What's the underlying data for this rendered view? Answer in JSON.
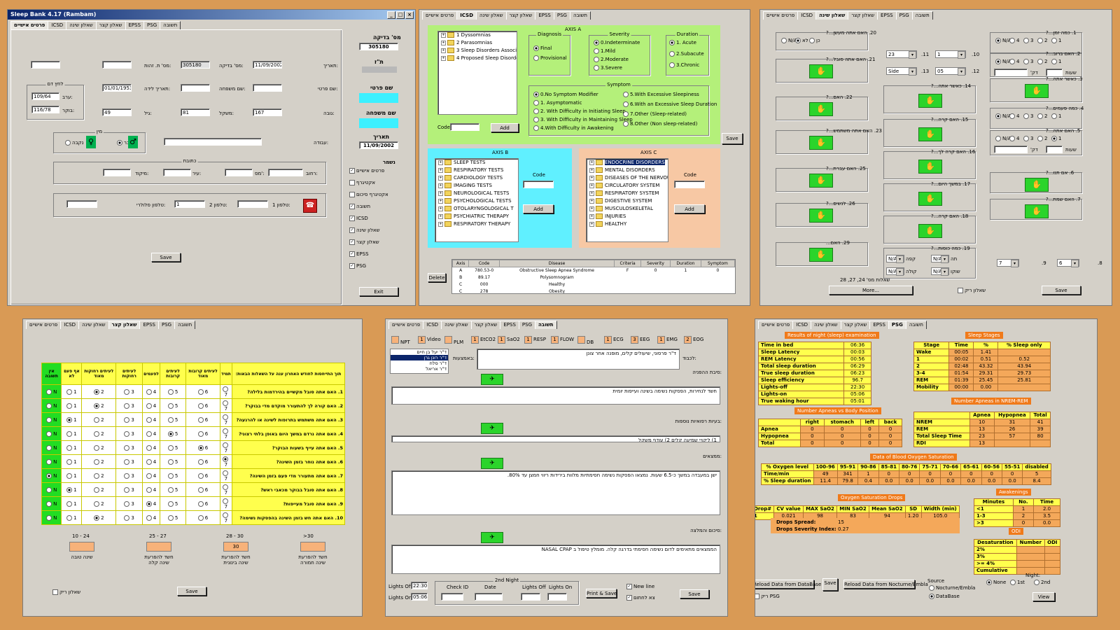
{
  "tabs_main": [
    "פרטים אישיים",
    "ICSD",
    "שאלון שינה",
    "שאלון קצר",
    "EPSS",
    "PSG",
    "תשובה"
  ],
  "p1": {
    "title": "Sleep Bank 4.17 (Rambam)",
    "test_no_label": "מס' בדיקה:",
    "test_no": "305180",
    "date_label": "תאריך:",
    "date": "11/09/2002",
    "id_label": "מס' ת. זהות:",
    "dob_label": "תאריך לידה:",
    "dob": "01/01/1953",
    "family_label": "שם משפחה:",
    "first_label": "שם פרטי:",
    "age_label": "גיל:",
    "age": "49",
    "weight_label": "משקל:",
    "weight": "81",
    "height_label": "גובה:",
    "height": "167",
    "bp_group": "לחץ דם",
    "bp_evening_label": "ערב:",
    "bp_evening": "109/64",
    "bp_morning_label": "בוקר:",
    "bp_morning": "116/78",
    "gender_group": "מין",
    "female": "נקבה",
    "male": "זכר",
    "work_label": "עבודה:",
    "address_group": "כתובת",
    "street_label": "רחוב:",
    "house_label": "מס':",
    "city_label": "עיר:",
    "zip_label": "מיקוד:",
    "phone1_label": "טלפון 1:",
    "phone2_label": "טלפון 2:",
    "phone2": "1",
    "cell_label": "טלפון סלולרי:",
    "save": "Save",
    "side_test_no_label": "מס' בדיקה",
    "side_test_no": "305180",
    "side_id_label": "ת\"ז",
    "side_first_label": "שם פרטי",
    "side_family_label": "שם משפחה",
    "side_date_label": "תאריך",
    "side_date": "11/09/2002",
    "exists_label": "נשמר",
    "checks": [
      {
        "label": "פרטים אישיים",
        "on": true
      },
      {
        "label": "אקטיגרף",
        "on": false
      },
      {
        "label": "אקטיגרף סיכום",
        "on": false
      },
      {
        "label": "תשובה",
        "on": true
      },
      {
        "label": "ICSD",
        "on": true
      },
      {
        "label": "שאלון שינה",
        "on": true
      },
      {
        "label": "שאלון קצר",
        "on": true
      },
      {
        "label": "EPSS",
        "on": true
      },
      {
        "label": "PSG",
        "on": true
      }
    ],
    "exit": "Exit"
  },
  "p2": {
    "axis_a": "AXIS A",
    "tree_a": [
      "1 Dyssomnias",
      "2 Parasomnias",
      "3 Sleep Disorders Associated w",
      "4 Proposed Sleep Disorders"
    ],
    "code_label": "Code",
    "add": "Add",
    "diagnosis": "Diagnosis",
    "diag_opts": [
      {
        "t": "Final",
        "on": true
      },
      {
        "t": "Provisional",
        "on": false
      }
    ],
    "severity": "Severity",
    "sev_opts": [
      {
        "t": "0.Indeterminate",
        "on": true
      },
      {
        "t": "1.Mild",
        "on": false
      },
      {
        "t": "2.Moderate",
        "on": false
      },
      {
        "t": "3.Severe",
        "on": false
      }
    ],
    "duration": "Duration",
    "dur_opts": [
      {
        "t": "1. Acute",
        "on": true
      },
      {
        "t": "2.Subacute",
        "on": false
      },
      {
        "t": "3.Chronic",
        "on": false
      }
    ],
    "symptom": "Symptom",
    "sym_left": [
      {
        "t": "0.No Symptom Modifier",
        "on": true
      },
      {
        "t": "1. Asymptomatic",
        "on": false
      },
      {
        "t": "2. With Difficulty in Initiating Sleep",
        "on": false
      },
      {
        "t": "3. With Difficulty in Maintaining Sleep",
        "on": false
      },
      {
        "t": "4.With Difficulty in Awakening",
        "on": false
      }
    ],
    "sym_right": [
      {
        "t": "5.With Excessive Sleepiness",
        "on": false
      },
      {
        "t": "6.With an Excessive Sleep Duration",
        "on": false
      },
      {
        "t": "7.Other (Sleep-related)",
        "on": false
      },
      {
        "t": "8.Other (Non sleep-related)",
        "on": false
      }
    ],
    "save": "Save",
    "axis_b": "AXIS B",
    "tree_b": [
      "SLEEP TESTS",
      "RESPIRATORY TESTS",
      "CARDIOLOGY TESTS",
      "IMAGING TESTS",
      "NEUROLOGICAL TESTS",
      "PSYCHOLOGICAL TESTS",
      "OTOLARYNGOLOGICAL T",
      "PSYCHIATRIC THERAPY",
      "RESPIRATORY THERAPY"
    ],
    "axis_c": "AXIS C",
    "tree_c": [
      "ENDOCRINE DISORDERS",
      "MENTAL DISORDERS",
      "DISEASES OF THE NERVOU",
      "CIRCULATORY SYSTEM",
      "RESPIRATORY SYSTEM",
      "DIGESTIVE SYSTEM",
      "MUSCULOSKELETAL",
      "INJURIES",
      "HEALTHY"
    ],
    "delete": "Delete",
    "grid_cols": [
      "Axis",
      "Code",
      "Disease",
      "Criteria",
      "Severity",
      "Duration",
      "Symptom"
    ],
    "grid_rows": [
      [
        "A",
        "780.53-0",
        "Obstructive Sleep Apnea Syndrome",
        "F",
        "0",
        "1",
        "0"
      ],
      [
        "B",
        "89.17",
        "Polysomnogram",
        "",
        "",
        "",
        ""
      ],
      [
        "C",
        "000",
        "Healthy",
        "",
        "",
        "",
        ""
      ],
      [
        "C",
        "278",
        "Obesity",
        "",
        "",
        "",
        ""
      ]
    ]
  },
  "p3": {
    "q_right": [
      "1. כמה זמן...?",
      "2. האם ברוב...?",
      "3. כאשר אתה...?",
      "4. כמה פעמים...?",
      "5. האם אתה...?",
      "6. אם תנו...?",
      "7. האם שמת...?"
    ],
    "q_mid": [
      "10.",
      "11.",
      "12.",
      "13.",
      "14. כאשר אתה...?",
      "15. האם קרה...?",
      "16. האם קרה לך...?",
      "17. במשך היום...?",
      "18. האם קרה...?",
      "19. כמה כוסות...?"
    ],
    "q_left": [
      "20. האם אתה מעשן...?",
      "21. האם אתה סובל...?",
      "22. האם...?",
      "23. האם אתה משתמש...?",
      "25. האם עברת...?",
      "26. לנשים...?",
      "29. האם..."
    ],
    "radio_opts": [
      "N/A",
      "4",
      "3",
      "2",
      "1"
    ],
    "yes_no": [
      "N/A",
      "לא",
      "כן"
    ],
    "dd1": "23",
    "dd2": "1",
    "dd3": "Side",
    "dd4": "05",
    "dd_na": "N/A",
    "minutes_label": "דק'",
    "hours_label": "שעות",
    "q9": "9.",
    "q8": "8.",
    "dd7": "7",
    "dd6": "6",
    "coffee": "קפה",
    "tea": "תה",
    "cola": "קולה",
    "choc": "שוקו",
    "more_caption": "שאלות מס' 24, 27, 28",
    "more": "More...",
    "empty_q": "שאלון ריק",
    "save": "Save"
  },
  "p4": {
    "headers": [
      "אין תשובה",
      "אף פעם לא",
      "לעיתים רחוקות מאוד",
      "לעיתים רחוקות",
      "לפעמים",
      "לעיתים קרובות",
      "לעיתים קרובות מאוד",
      "תמיד",
      "תוך התייחסות לחודש האחרון ענה על השאלות הבאות:"
    ],
    "rows": [
      {
        "q": "1. האם אתה סובל מקשיים בהירדמות בלילה?",
        "sel": 2
      },
      {
        "q": "2. האם קורה לך להתעורר מוקדם מדי בבוקר?",
        "sel": 2
      },
      {
        "q": "3. האם אתה משתמש בתרופות לשינה או להרגעה?",
        "sel": 1
      },
      {
        "q": "4. האם אתה נרדם במשך היום באופן בלתי רצוני?",
        "sel": 5
      },
      {
        "q": "5. האם אתה עייף בשעות הבוקר?",
        "sel": 6
      },
      {
        "q": "6. האם אתה נוחר בזמן השינה?",
        "sel": 7
      },
      {
        "q": "7. האם אתה מתעורר מדי פעם בזמן השינה?",
        "sel": 0
      },
      {
        "q": "8. האם אתה סובל בבוקר מכאבי ראש?",
        "sel": 1
      },
      {
        "q": "9. האם אתה סובל מעייפות?",
        "sel": 4
      },
      {
        "q": "10. האם אתה חש בזמן השינה בהפסקות נשימה?",
        "sel": 2
      }
    ],
    "ranges": [
      "10 - 24",
      "25 - 27",
      "28 - 30",
      ">30"
    ],
    "score": "30",
    "range_labels": [
      "שינה טובה",
      "חשד להפרעת שינה קלה",
      "חשד להפרעת שינה בינונית",
      "חשד להפרעת שינה חמורה"
    ],
    "empty_q": "שאלון ריק",
    "save": "Save"
  },
  "p5": {
    "channels": [
      [
        "NPT",
        ""
      ],
      [
        "Video",
        "1"
      ],
      [
        "PLM",
        ""
      ],
      [
        "EtCO2",
        "1"
      ],
      [
        "SaO2",
        "1"
      ],
      [
        "RESP",
        "1"
      ],
      [
        "FLOW",
        "1"
      ],
      [
        "DB",
        ""
      ],
      [
        "ECG",
        "1"
      ],
      [
        "EEG",
        "3"
      ],
      [
        "EMG",
        "1"
      ],
      [
        "EOG",
        "2"
      ]
    ],
    "doctors": [
      "ד\"ר יעל בן חיים",
      "ד\"ר רונן גרן",
      "ד\"ר סלח",
      "ד\"ר אריאל"
    ],
    "doc_label": "לכבוד:",
    "doc_text": "ד\"ר פרסוני, שיעולים קלים, מופנה אחר צונן",
    "referral_label": "באמצעות:",
    "s1_label": "סיבת ההפניה:",
    "s1_text": "חשד לנחירות, הפסקות נשימה בשינה ועייפות יומית",
    "s2_label": "בעיות רפואיות נוספות:",
    "s2_text": "1) ליקויי שמיעה קלים 2) עודף משקל",
    "s3_label": "ממצאים:",
    "s3_text": "ישן במעבדה במשך כ-6.5 שעות. נמצאו הפסקות נשימה חסימתיות מלוות בירידות ריווי חמצן עד 80%.",
    "s4_label": "סיכום והמלצה:",
    "s4_text": "הממצאים מתאימים לדום נשימה חסימתי בדרגה קלה. מומלץ טיפול ב NASAL CPAP",
    "lights_off_label": "Lights Off:",
    "lights_off": "22:30",
    "lights_on_label": "Lights On:",
    "lights_on": "05:06",
    "second_night": "2nd Night",
    "check_id": "Check ID",
    "date": "Date",
    "lights_off2": "Lights Off",
    "lights_on2": "Lights On",
    "print_save": "Print & Save",
    "new_line": "New line",
    "to_print": "צא לחתום",
    "save": "Save"
  },
  "p6": {
    "t1_title": "Results of night (sleep) examination",
    "t1": [
      [
        "Time in bed",
        "06:36"
      ],
      [
        "Sleep Latency",
        "00:03"
      ],
      [
        "REM Latency",
        "00:56"
      ],
      [
        "Total sleep duration",
        "06:29"
      ],
      [
        "True sleep duration",
        "06:23"
      ],
      [
        "Sleep efficiency",
        "96.7"
      ],
      [
        "Lights-off",
        "22:30"
      ],
      [
        "Lights-on",
        "05:06"
      ],
      [
        "True waking hour",
        "05:01"
      ]
    ],
    "t2_title": "Sleep Stages",
    "t2_head": [
      "Stage",
      "Time",
      "%",
      "% Sleep only"
    ],
    "t2": [
      [
        "Wake",
        "00:05",
        "1.41",
        ""
      ],
      [
        "1",
        "00:02",
        "0.51",
        "0.52"
      ],
      [
        "2",
        "02:48",
        "43.32",
        "43.94"
      ],
      [
        "3-4",
        "01:54",
        "29.31",
        "29.73"
      ],
      [
        "REM",
        "01:39",
        "25.45",
        "25.81"
      ],
      [
        "Mobility",
        "00:00",
        "0.00",
        ""
      ]
    ],
    "t3_title": "Number Apneas vs Body Position",
    "t3_head": [
      "",
      "right",
      "stomach",
      "left",
      "back"
    ],
    "t3": [
      [
        "Apnea",
        "0",
        "0",
        "0",
        "0"
      ],
      [
        "Hypopnea",
        "0",
        "0",
        "0",
        "0"
      ],
      [
        "Total",
        "0",
        "0",
        "0",
        "0"
      ]
    ],
    "t4_title": "Number Apneas in NREM-REM",
    "t4_head": [
      "",
      "Apnea",
      "Hypopnea",
      "Total"
    ],
    "t4": [
      [
        "NREM",
        "10",
        "31",
        "41"
      ],
      [
        "REM",
        "13",
        "26",
        "39"
      ],
      [
        "Total Sleep Time",
        "23",
        "57",
        "80"
      ],
      [
        "RDI",
        "13",
        "",
        ""
      ]
    ],
    "t5_title": "Data of Blood Oxygen Saturation",
    "t5_head": [
      "% Oxygen level",
      "100-96",
      "95-91",
      "90-86",
      "85-81",
      "80-76",
      "75-71",
      "70-66",
      "65-61",
      "60-56",
      "55-51",
      "disabled"
    ],
    "t5": [
      [
        "Time/min",
        "49",
        "341",
        "1",
        "0",
        "0",
        "0",
        "0",
        "0",
        "0",
        "0",
        "5"
      ],
      [
        "% Sleep duration",
        "11.4",
        "79.8",
        "0.4",
        "0.0",
        "0.0",
        "0.0",
        "0.0",
        "0.0",
        "0.0",
        "0.0",
        "8.4"
      ]
    ],
    "t6_title": "Oxygen Saturation Drops",
    "t6_head": [
      "Drop#",
      "CV value",
      "MAX SaO2",
      "MIN SaO2",
      "Mean SaO2",
      "SD",
      "Width (min)"
    ],
    "t6": [
      [
        "1",
        "0.021",
        "98",
        "83",
        "94",
        "1.20",
        "105.0"
      ]
    ],
    "spread_label": "Drops Spread:",
    "spread": "15",
    "severity_label": "Drops Severity Index:",
    "severity": "0.27",
    "t7_title": "Awakenings",
    "t7_head": [
      "Minutes",
      "No.",
      "Time"
    ],
    "t7": [
      [
        "<1",
        "1",
        "2.0"
      ],
      [
        "1-3",
        "2",
        "3.5"
      ],
      [
        ">3",
        "0",
        "0.0"
      ]
    ],
    "t8_title": "ODI",
    "t8_head": [
      "Desaturation",
      "Number",
      "ODI"
    ],
    "t8": [
      [
        "2%",
        "",
        ""
      ],
      [
        "3%",
        "",
        ""
      ],
      [
        ">= 4%",
        "",
        ""
      ],
      [
        "Cumulative",
        "",
        ""
      ]
    ],
    "reload_db": "Reload Data from DataBase",
    "save": "Save",
    "reload_noct": "Reload Data from Nocturne/Embla",
    "source": "Source",
    "src_opts": [
      {
        "t": "Nocturne/Embla",
        "on": false
      },
      {
        "t": "DataBase",
        "on": true
      }
    ],
    "night": "Night:",
    "night_opts": [
      {
        "t": "None",
        "on": true
      },
      {
        "t": "1st",
        "on": false
      },
      {
        "t": "2nd",
        "on": false
      }
    ],
    "view": "View",
    "empty_psg": "ריק PSG"
  }
}
